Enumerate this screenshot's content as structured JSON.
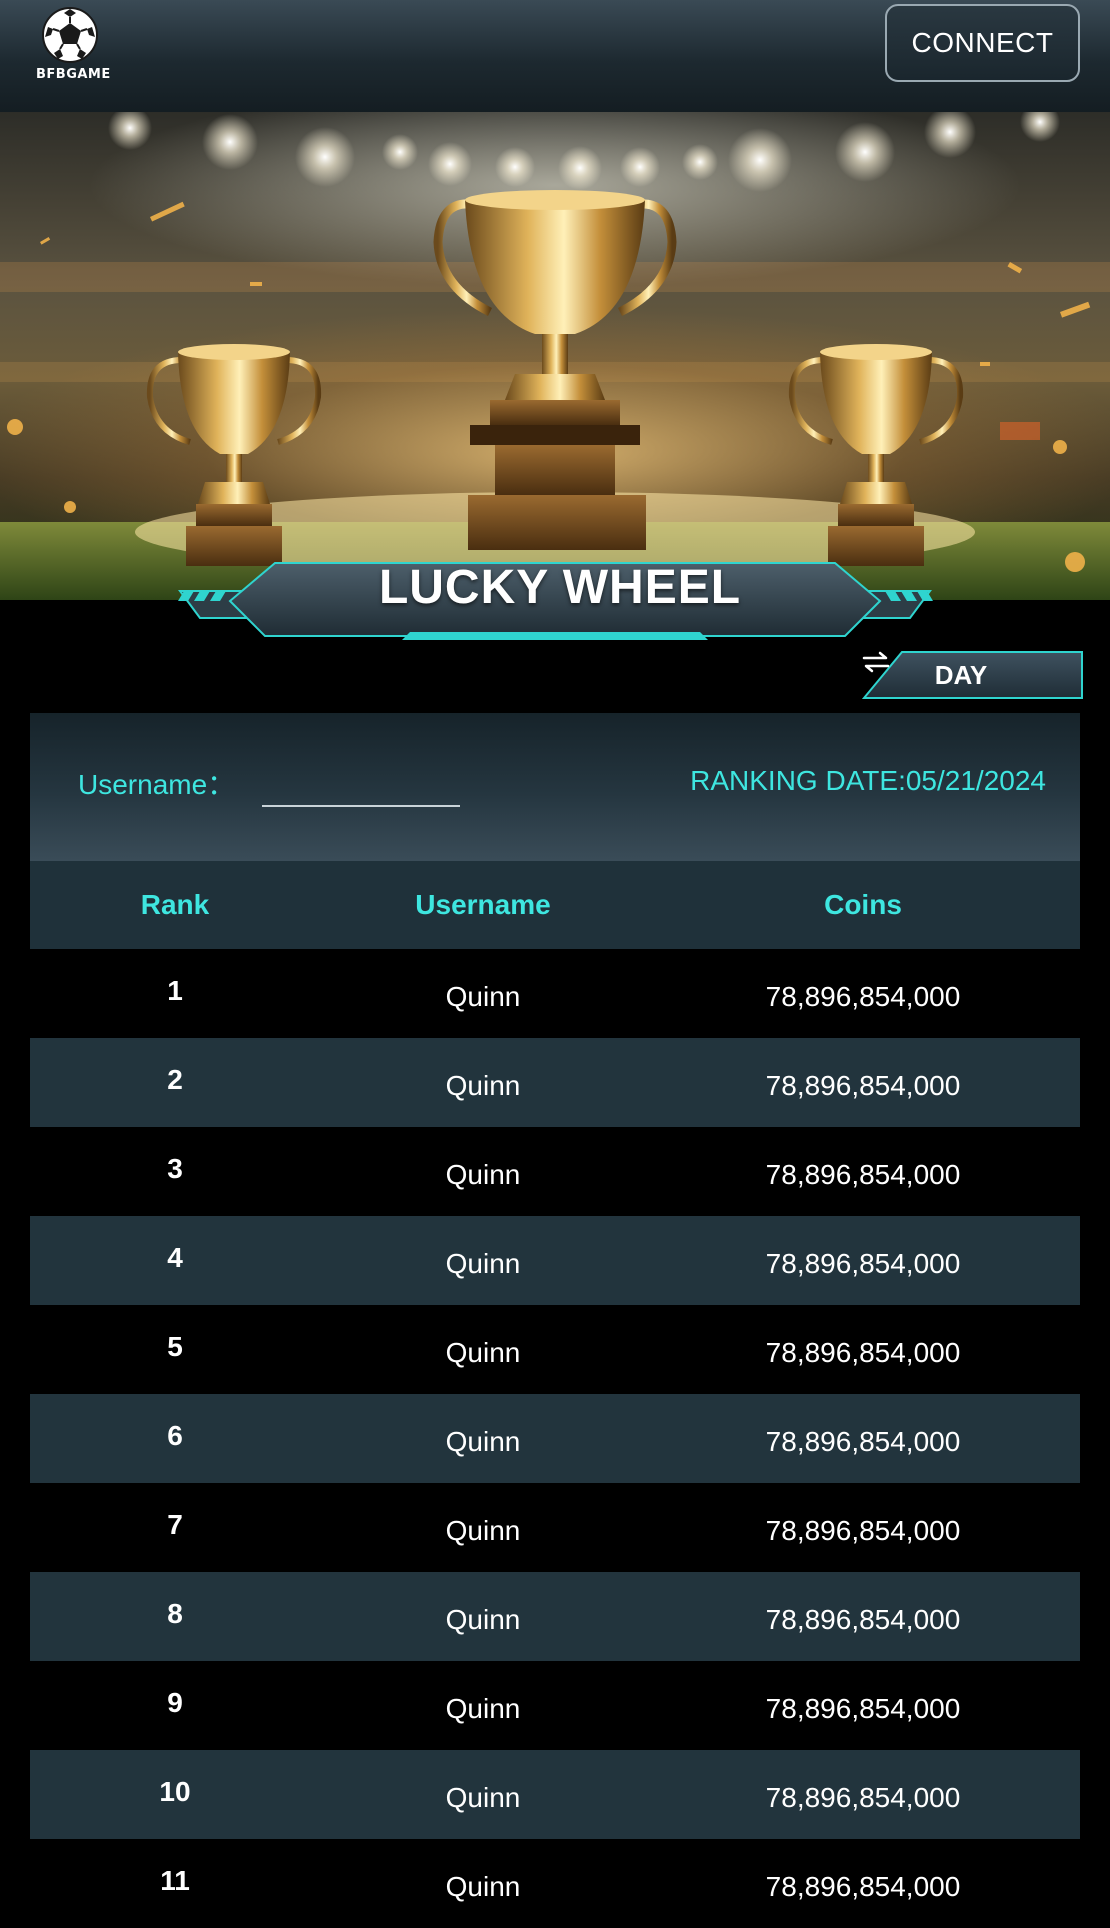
{
  "header": {
    "logo_text": "BFBGAME",
    "connect_label": "CONNECT"
  },
  "banner": {
    "title": "LUCKY WHEEL"
  },
  "period": {
    "label": "DAY",
    "icon": "swap-arrows-icon"
  },
  "filter": {
    "username_label": "Username：",
    "username_value": "",
    "ranking_date": "RANKING DATE:05/21/2024"
  },
  "table": {
    "headers": {
      "rank": "Rank",
      "username": "Username",
      "coins": "Coins"
    },
    "rows": [
      {
        "rank": "1",
        "username": "Quinn",
        "coins": "78,896,854,000"
      },
      {
        "rank": "2",
        "username": "Quinn",
        "coins": "78,896,854,000"
      },
      {
        "rank": "3",
        "username": "Quinn",
        "coins": "78,896,854,000"
      },
      {
        "rank": "4",
        "username": "Quinn",
        "coins": "78,896,854,000"
      },
      {
        "rank": "5",
        "username": "Quinn",
        "coins": "78,896,854,000"
      },
      {
        "rank": "6",
        "username": "Quinn",
        "coins": "78,896,854,000"
      },
      {
        "rank": "7",
        "username": "Quinn",
        "coins": "78,896,854,000"
      },
      {
        "rank": "8",
        "username": "Quinn",
        "coins": "78,896,854,000"
      },
      {
        "rank": "9",
        "username": "Quinn",
        "coins": "78,896,854,000"
      },
      {
        "rank": "10",
        "username": "Quinn",
        "coins": "78,896,854,000"
      },
      {
        "rank": "11",
        "username": "Quinn",
        "coins": "78,896,854,000"
      }
    ]
  },
  "colors": {
    "accent": "#3ee6e0",
    "row_alt": "#22343d",
    "background": "#000000"
  }
}
